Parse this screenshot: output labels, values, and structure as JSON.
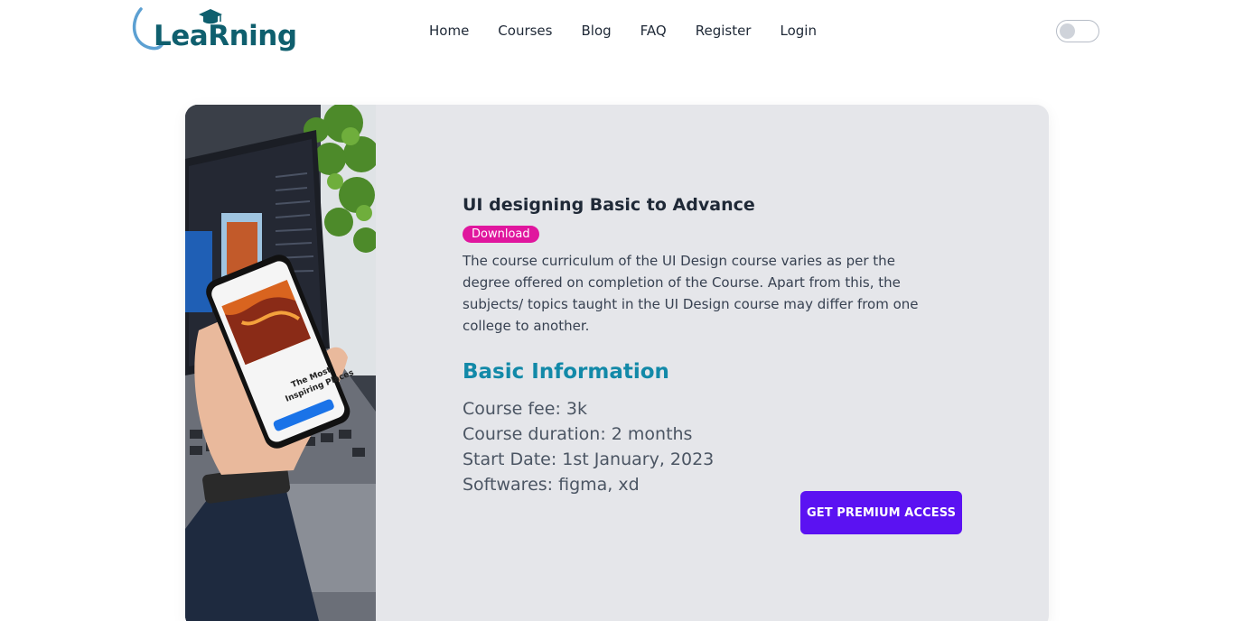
{
  "brand": {
    "logo_text": "LeaRning"
  },
  "nav": {
    "items": [
      {
        "label": "Home"
      },
      {
        "label": "Courses"
      },
      {
        "label": "Blog"
      },
      {
        "label": "FAQ"
      },
      {
        "label": "Register"
      },
      {
        "label": "Login"
      }
    ]
  },
  "theme_toggle": {
    "state": "off"
  },
  "course": {
    "title": "UI designing Basic to Advance",
    "badge": "Download",
    "description": "The course curriculum of the UI Design course varies as per the degree offered on completion of the Course. Apart from this, the subjects/ topics taught in the UI Design course may differ from one college to another.",
    "info_heading": "Basic Information",
    "fee": "Course fee: 3k",
    "duration": "Course duration: 2 months",
    "start_date": "Start Date: 1st January, 2023",
    "softwares": "Softwares: figma, xd",
    "cta_label": "GET PREMIUM ACCESS"
  },
  "image": {
    "phone_headline_1": "The Most",
    "phone_headline_2": "Inspiring Places"
  },
  "colors": {
    "brand_teal": "#0f5f6e",
    "accent_blue": "#1289a8",
    "badge_pink": "#e0169e",
    "cta_purple": "#5b12f2",
    "card_gray": "#e5e6ea"
  }
}
